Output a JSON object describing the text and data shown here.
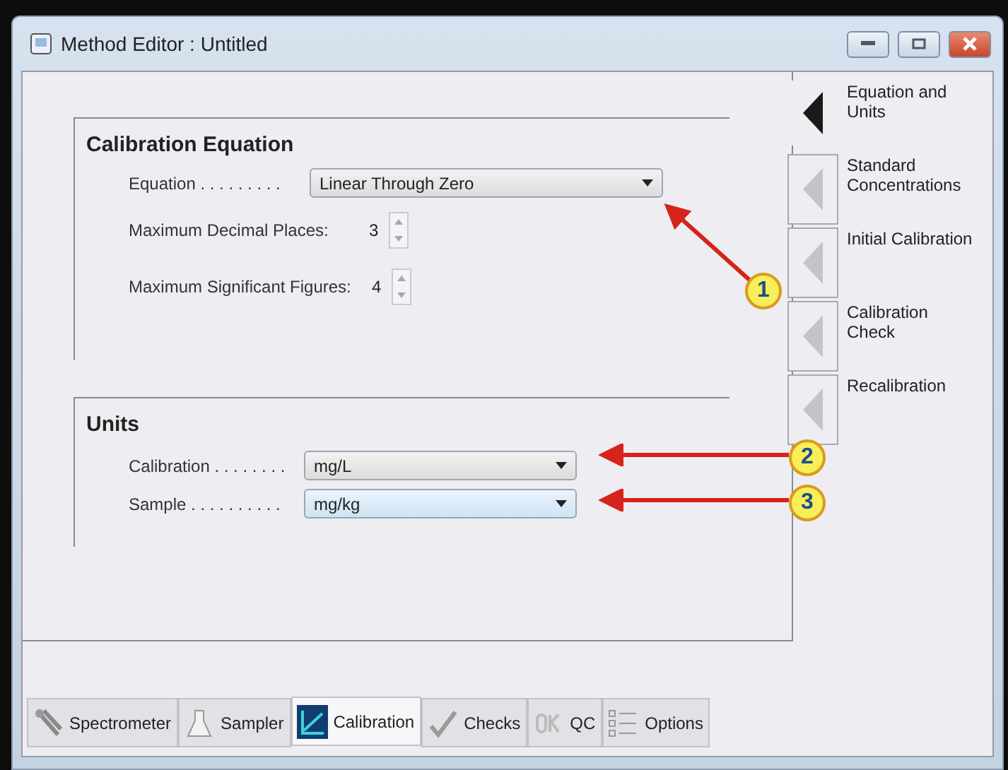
{
  "window": {
    "title": "Method Editor : Untitled"
  },
  "calibration_equation": {
    "heading": "Calibration Equation",
    "equation": {
      "label": "Equation . . . . . . . . .",
      "value": "Linear Through Zero"
    },
    "spinners": [
      {
        "label": "Maximum Decimal Places:",
        "value": "3"
      },
      {
        "label": "Maximum Significant Figures:",
        "value": "4"
      }
    ]
  },
  "units": {
    "heading": "Units",
    "fields": [
      {
        "label": "Calibration . . . . . . . .",
        "value": "mg/L",
        "highlighted": false
      },
      {
        "label": "Sample . . . . . . . . . .",
        "value": "mg/kg",
        "highlighted": true
      }
    ]
  },
  "side_tabs": [
    {
      "label": "Equation and Units",
      "selected": true
    },
    {
      "label": "Standard Concentrations",
      "selected": false
    },
    {
      "label": "Initial Calibration",
      "selected": false
    },
    {
      "label": "Calibration Check",
      "selected": false
    },
    {
      "label": "Recalibration",
      "selected": false
    }
  ],
  "bottom_tabs": [
    {
      "label": "Spectrometer",
      "kind": "tools",
      "selected": false
    },
    {
      "label": "Sampler",
      "kind": "flask",
      "selected": false
    },
    {
      "label": "Calibration",
      "kind": "graph",
      "selected": true
    },
    {
      "label": "Checks",
      "kind": "tick",
      "selected": false
    },
    {
      "label": "QC",
      "kind": "ok",
      "selected": false
    },
    {
      "label": "Options",
      "kind": "list",
      "selected": false
    }
  ],
  "callouts": [
    {
      "label": "1"
    },
    {
      "label": "2"
    },
    {
      "label": "3"
    }
  ]
}
